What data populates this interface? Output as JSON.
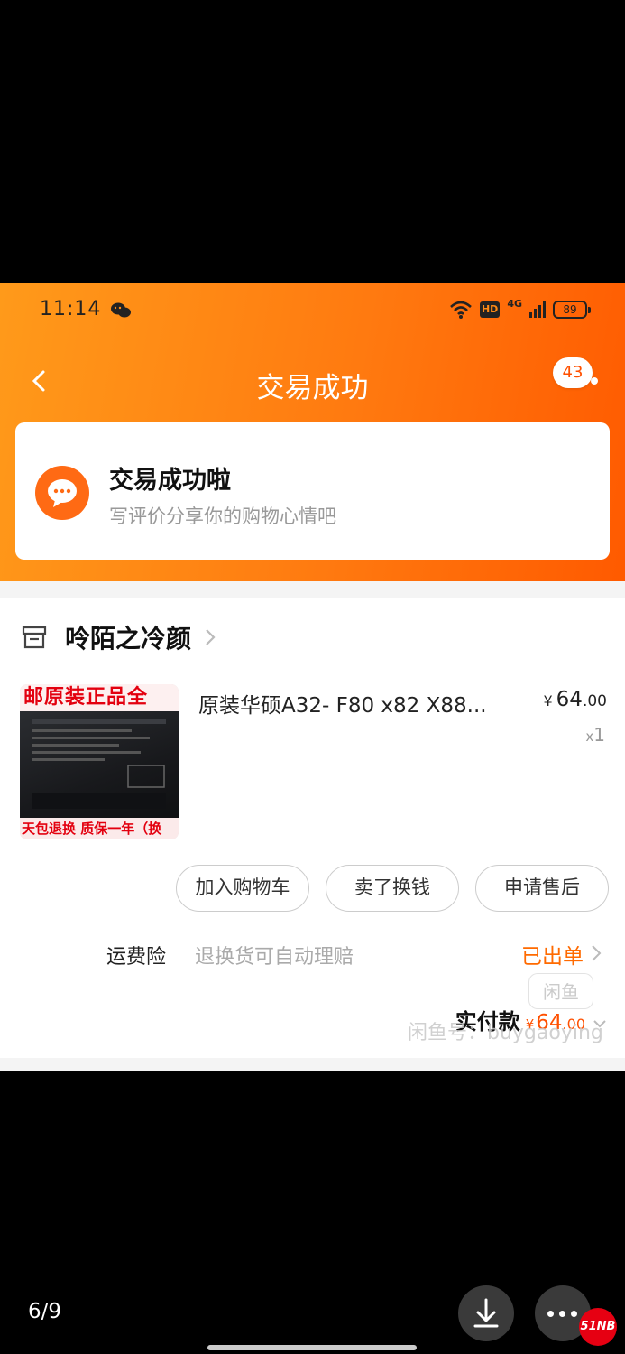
{
  "status_bar": {
    "time": "11:14",
    "hd": "HD",
    "network": "4G",
    "battery": "89"
  },
  "nav": {
    "title": "交易成功",
    "badge": "43"
  },
  "success_card": {
    "title": "交易成功啦",
    "subtitle": "写评价分享你的购物心情吧"
  },
  "shop": {
    "name": "呤陌之冷颜"
  },
  "product": {
    "name": "原装华硕A32- F80 x82 X88...",
    "price_currency": "¥",
    "price_int": "64",
    "price_dec": ".00",
    "qty_prefix": "x",
    "qty": "1",
    "image_text_top": "邮原装正品全",
    "image_text_bottom": "天包退换 质保一年（换"
  },
  "actions": {
    "add_cart": "加入购物车",
    "resell": "卖了换钱",
    "after_sale": "申请售后"
  },
  "insurance": {
    "label": "运费险",
    "desc": "退换货可自动理赔",
    "status": "已出单"
  },
  "paid": {
    "label": "实付款",
    "currency": "¥",
    "amount_int": "64",
    "amount_dec": ".00"
  },
  "watermark": {
    "logo": "闲鱼",
    "text": "闲鱼号：buygaoying"
  },
  "viewer": {
    "page": "6/9",
    "logo": "51NB"
  },
  "colors": {
    "accent": "#ff6a00",
    "hero_start": "#ff9a1a",
    "hero_end": "#ff5a00"
  }
}
